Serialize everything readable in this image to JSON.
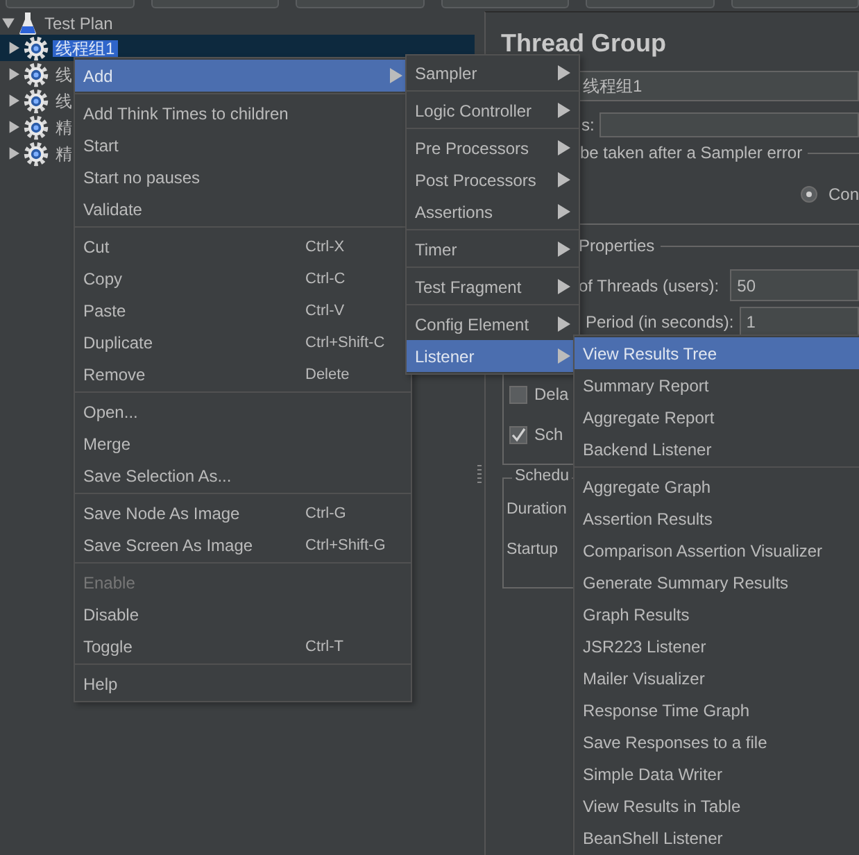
{
  "tree": [
    {
      "label": "Test Plan",
      "expanded": true,
      "selected": false,
      "children": [
        {
          "label": "线程组1",
          "selected": true,
          "expanded": false
        },
        {
          "label": "线",
          "selected": false,
          "expanded": false
        },
        {
          "label": "线",
          "selected": false,
          "expanded": false
        },
        {
          "label": "精",
          "selected": false,
          "expanded": false
        },
        {
          "label": "精",
          "selected": false,
          "expanded": false
        }
      ]
    }
  ],
  "thread_group": {
    "title": "Thread Group",
    "name_value": "线程组1",
    "comments_label": "s:",
    "error_action_legend": "be taken after a Sampler error",
    "error_action_option": {
      "label": "Con",
      "selected": true
    },
    "properties_legend": "Properties",
    "threads": {
      "label": "of Threads (users):",
      "value": "50"
    },
    "ramp_up": {
      "label": "Period (in seconds):",
      "value": "1"
    },
    "checkboxes": [
      {
        "label": "Dela",
        "checked": false
      },
      {
        "label": "Sch",
        "checked": true
      }
    ],
    "scheduler_legend": "Schedu",
    "scheduler_fields": [
      "Duration",
      "Startup"
    ]
  },
  "context_menu": [
    {
      "kind": "submenu",
      "label": "Add",
      "selected": true,
      "disabled": false
    },
    {
      "kind": "separator"
    },
    {
      "kind": "item",
      "label": "Add Think Times to children",
      "selected": false,
      "disabled": false
    },
    {
      "kind": "item",
      "label": "Start",
      "selected": false,
      "disabled": false
    },
    {
      "kind": "item",
      "label": "Start no pauses",
      "selected": false,
      "disabled": false
    },
    {
      "kind": "item",
      "label": "Validate",
      "selected": false,
      "disabled": false
    },
    {
      "kind": "separator"
    },
    {
      "kind": "item",
      "label": "Cut",
      "shortcut": "Ctrl-X",
      "selected": false,
      "disabled": false
    },
    {
      "kind": "item",
      "label": "Copy",
      "shortcut": "Ctrl-C",
      "selected": false,
      "disabled": false
    },
    {
      "kind": "item",
      "label": "Paste",
      "shortcut": "Ctrl-V",
      "selected": false,
      "disabled": false
    },
    {
      "kind": "item",
      "label": "Duplicate",
      "shortcut": "Ctrl+Shift-C",
      "selected": false,
      "disabled": false
    },
    {
      "kind": "item",
      "label": "Remove",
      "shortcut": "Delete",
      "selected": false,
      "disabled": false
    },
    {
      "kind": "separator"
    },
    {
      "kind": "item",
      "label": "Open...",
      "selected": false,
      "disabled": false
    },
    {
      "kind": "item",
      "label": "Merge",
      "selected": false,
      "disabled": false
    },
    {
      "kind": "item",
      "label": "Save Selection As...",
      "selected": false,
      "disabled": false
    },
    {
      "kind": "separator"
    },
    {
      "kind": "item",
      "label": "Save Node As Image",
      "shortcut": "Ctrl-G",
      "selected": false,
      "disabled": false
    },
    {
      "kind": "item",
      "label": "Save Screen As Image",
      "shortcut": "Ctrl+Shift-G",
      "selected": false,
      "disabled": false
    },
    {
      "kind": "separator"
    },
    {
      "kind": "item",
      "label": "Enable",
      "selected": false,
      "disabled": true
    },
    {
      "kind": "item",
      "label": "Disable",
      "selected": false,
      "disabled": false
    },
    {
      "kind": "item",
      "label": "Toggle",
      "shortcut": "Ctrl-T",
      "selected": false,
      "disabled": false
    },
    {
      "kind": "separator"
    },
    {
      "kind": "item",
      "label": "Help",
      "selected": false,
      "disabled": false
    }
  ],
  "add_submenu": [
    {
      "kind": "submenu",
      "label": "Sampler",
      "selected": false,
      "disabled": false
    },
    {
      "kind": "separator"
    },
    {
      "kind": "submenu",
      "label": "Logic Controller",
      "selected": false,
      "disabled": false
    },
    {
      "kind": "separator"
    },
    {
      "kind": "submenu",
      "label": "Pre Processors",
      "selected": false,
      "disabled": false
    },
    {
      "kind": "submenu",
      "label": "Post Processors",
      "selected": false,
      "disabled": false
    },
    {
      "kind": "submenu",
      "label": "Assertions",
      "selected": false,
      "disabled": false
    },
    {
      "kind": "separator"
    },
    {
      "kind": "submenu",
      "label": "Timer",
      "selected": false,
      "disabled": false
    },
    {
      "kind": "separator"
    },
    {
      "kind": "submenu",
      "label": "Test Fragment",
      "selected": false,
      "disabled": false
    },
    {
      "kind": "separator"
    },
    {
      "kind": "submenu",
      "label": "Config Element",
      "selected": false,
      "disabled": false
    },
    {
      "kind": "submenu",
      "label": "Listener",
      "selected": true,
      "disabled": false
    }
  ],
  "listener_submenu": [
    {
      "kind": "item",
      "label": "View Results Tree",
      "selected": true,
      "disabled": false
    },
    {
      "kind": "item",
      "label": "Summary Report",
      "selected": false,
      "disabled": false
    },
    {
      "kind": "item",
      "label": "Aggregate Report",
      "selected": false,
      "disabled": false
    },
    {
      "kind": "item",
      "label": "Backend Listener",
      "selected": false,
      "disabled": false
    },
    {
      "kind": "separator"
    },
    {
      "kind": "item",
      "label": "Aggregate Graph",
      "selected": false,
      "disabled": false
    },
    {
      "kind": "item",
      "label": "Assertion Results",
      "selected": false,
      "disabled": false
    },
    {
      "kind": "item",
      "label": "Comparison Assertion Visualizer",
      "selected": false,
      "disabled": false
    },
    {
      "kind": "item",
      "label": "Generate Summary Results",
      "selected": false,
      "disabled": false
    },
    {
      "kind": "item",
      "label": "Graph Results",
      "selected": false,
      "disabled": false
    },
    {
      "kind": "item",
      "label": "JSR223 Listener",
      "selected": false,
      "disabled": false
    },
    {
      "kind": "item",
      "label": "Mailer Visualizer",
      "selected": false,
      "disabled": false
    },
    {
      "kind": "item",
      "label": "Response Time Graph",
      "selected": false,
      "disabled": false
    },
    {
      "kind": "item",
      "label": "Save Responses to a file",
      "selected": false,
      "disabled": false
    },
    {
      "kind": "item",
      "label": "Simple Data Writer",
      "selected": false,
      "disabled": false
    },
    {
      "kind": "item",
      "label": "View Results in Table",
      "selected": false,
      "disabled": false
    },
    {
      "kind": "item",
      "label": "BeanShell Listener",
      "selected": false,
      "disabled": false
    }
  ]
}
